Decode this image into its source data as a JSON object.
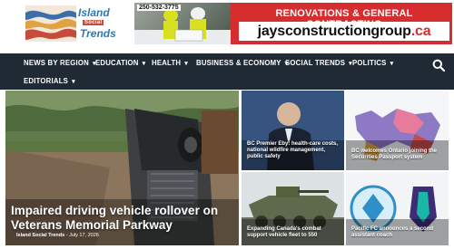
{
  "header": {
    "logo": {
      "word1": "Island",
      "word2": "Social",
      "word3": "Trends"
    },
    "ad": {
      "phone": "250-532-3775",
      "tagline": "RENOVATIONS & GENERAL CONTRACTING",
      "domain_prefix": "jays",
      "domain_main": "constructiongroup",
      "domain_suffix": ".ca"
    }
  },
  "nav": {
    "items": [
      {
        "label": "NEWS BY REGION"
      },
      {
        "label": "EDUCATION"
      },
      {
        "label": "HEALTH"
      },
      {
        "label": "BUSINESS & ECONOMY"
      },
      {
        "label": "SOCIAL TRENDS"
      },
      {
        "label": "POLITICS"
      },
      {
        "label": "EDITORIALS"
      }
    ],
    "search_icon": "search-icon",
    "caret_icon": "chevron-down-icon"
  },
  "feature": {
    "title": "Impaired driving vehicle rollover on Veterans Memorial Parkway",
    "author": "Island Social Trends",
    "date": "July 17, 2026"
  },
  "cards": [
    {
      "title": "BC Premier Eby: health-care costs, national wildfire management, public safety"
    },
    {
      "title": "BC welcomes Ontario joining the Securities Passport system"
    },
    {
      "title": "Expanding Canada's combat support vehicle fleet to 550"
    },
    {
      "title": "Pacific FC announces a second assistant coach"
    }
  ],
  "colors": {
    "nav_bg": "#1f2a34",
    "accent_red": "#d62d2f",
    "brand_blue": "#2d78b7"
  }
}
